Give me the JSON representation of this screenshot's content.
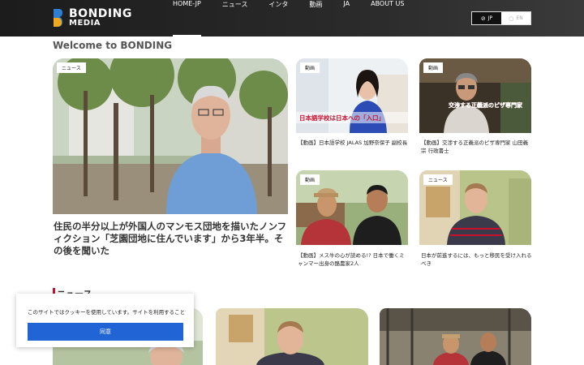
{
  "header": {
    "logo_line1": "BONDING",
    "logo_line2": "MEDIA",
    "nav": [
      "HOME-JP",
      "ニュース",
      "インタ",
      "動画",
      "JA",
      "ABOUT US"
    ],
    "lang": {
      "jp": "JP",
      "en": "EN"
    }
  },
  "main": {
    "welcome": "Welcome to BONDING",
    "feature": {
      "tag": "ニュース",
      "title": "住民の半分以上が外国人のマンモス団地を描いたノンフィクション「芝園団地に住んでいます」から3年半。その後を聞いた"
    },
    "cards": [
      {
        "tag": "動画",
        "title": "【動画】日本語学校 JALAS 加野奈保子 副校長",
        "overlay": "日本語学校は日本への「入口」"
      },
      {
        "tag": "動画",
        "title": "【動画】交渉する正義派のピザ専門家 山田義宗 行政書士",
        "overlay": "交渉する正義派のピザ専門家"
      },
      {
        "tag": "動画",
        "title": "【動画】メス牛の心が読める!? 日本で働くミャンマー出身の酪農家2人",
        "overlay": ""
      },
      {
        "tag": "ニュース",
        "title": "日本が前進するには、もっと移民を受け入れるべき",
        "overlay": ""
      }
    ]
  },
  "section": {
    "title": "ニュース"
  },
  "cookie": {
    "text": "このサイトではクッキーを使用しています。サイトを利用することで、クッキーの使用に同意したことになります。",
    "button": "同意"
  },
  "colors": {
    "header_bg": "#222222",
    "accent_red": "#c8102e",
    "cookie_button": "#2064d6"
  }
}
